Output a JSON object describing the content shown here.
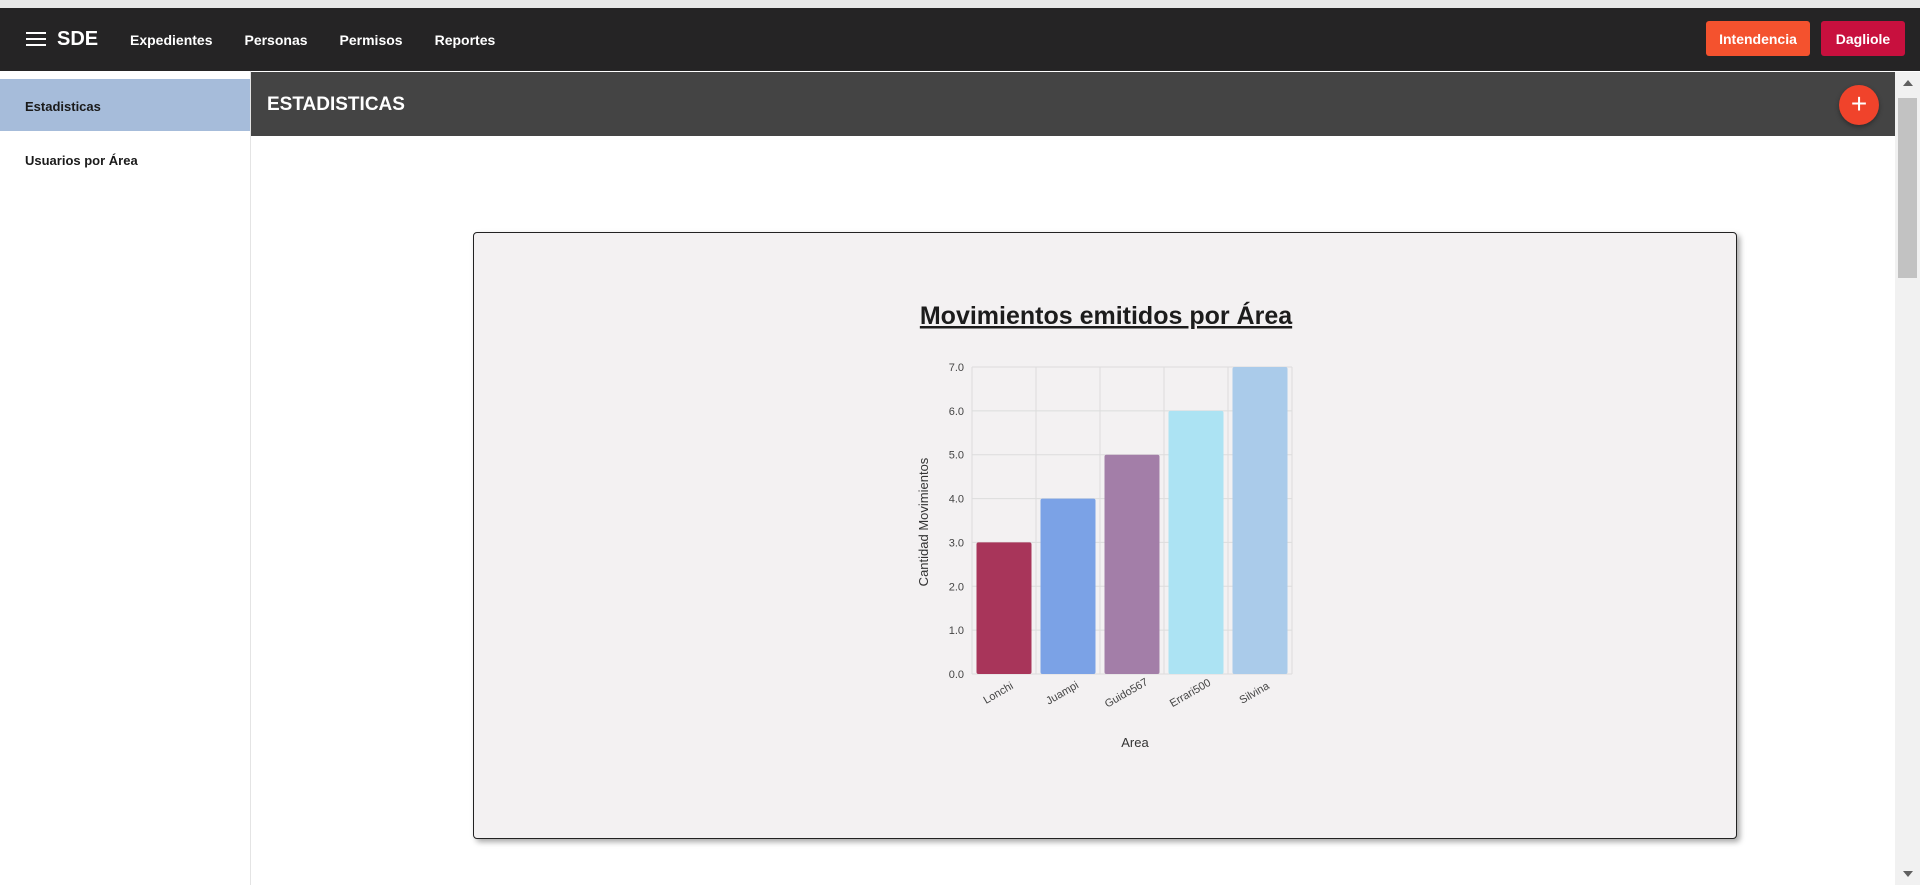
{
  "app": {
    "brand": "SDE",
    "nav": [
      "Expedientes",
      "Personas",
      "Permisos",
      "Reportes"
    ],
    "area_button": "Intendencia",
    "user_button": "Dagliole"
  },
  "sidebar": {
    "items": [
      {
        "label": "Estadisticas",
        "active": true
      },
      {
        "label": "Usuarios por Área",
        "active": false
      }
    ]
  },
  "page": {
    "title": "ESTADISTICAS",
    "fab_label": "+"
  },
  "colors": {
    "appbar": "#252425",
    "area_button": "#f4522e",
    "user_button": "#c8103e",
    "sidebar_active": "#a6bcda",
    "header": "#444444",
    "fab": "#f0432b"
  },
  "chart_data": {
    "type": "bar",
    "title": "Movimientos emitidos por Área",
    "xlabel": "Area",
    "ylabel": "Cantidad Movimientos",
    "categories": [
      "Lonchi",
      "Juampi",
      "Guido567",
      "Errari500",
      "Silvina"
    ],
    "values": [
      3,
      4,
      5,
      6,
      7
    ],
    "colors": [
      "#a8355a",
      "#7ba2e6",
      "#a37ea8",
      "#ace3f3",
      "#aacbea"
    ],
    "ylim": [
      0,
      7
    ],
    "yticks": [
      "0.0",
      "1.0",
      "2.0",
      "3.0",
      "4.0",
      "5.0",
      "6.0",
      "7.0"
    ],
    "grid": true,
    "legend": "none"
  }
}
